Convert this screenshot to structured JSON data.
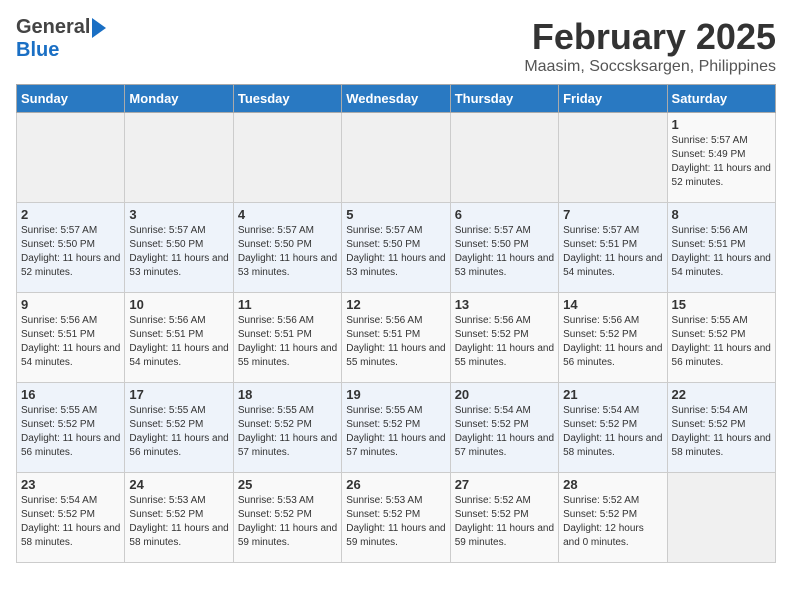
{
  "header": {
    "logo_general": "General",
    "logo_blue": "Blue",
    "title": "February 2025",
    "subtitle": "Maasim, Soccsksargen, Philippines"
  },
  "weekdays": [
    "Sunday",
    "Monday",
    "Tuesday",
    "Wednesday",
    "Thursday",
    "Friday",
    "Saturday"
  ],
  "weeks": [
    [
      {
        "day": "",
        "info": ""
      },
      {
        "day": "",
        "info": ""
      },
      {
        "day": "",
        "info": ""
      },
      {
        "day": "",
        "info": ""
      },
      {
        "day": "",
        "info": ""
      },
      {
        "day": "",
        "info": ""
      },
      {
        "day": "1",
        "info": "Sunrise: 5:57 AM\nSunset: 5:49 PM\nDaylight: 11 hours\nand 52 minutes."
      }
    ],
    [
      {
        "day": "2",
        "info": "Sunrise: 5:57 AM\nSunset: 5:50 PM\nDaylight: 11 hours\nand 52 minutes."
      },
      {
        "day": "3",
        "info": "Sunrise: 5:57 AM\nSunset: 5:50 PM\nDaylight: 11 hours\nand 53 minutes."
      },
      {
        "day": "4",
        "info": "Sunrise: 5:57 AM\nSunset: 5:50 PM\nDaylight: 11 hours\nand 53 minutes."
      },
      {
        "day": "5",
        "info": "Sunrise: 5:57 AM\nSunset: 5:50 PM\nDaylight: 11 hours\nand 53 minutes."
      },
      {
        "day": "6",
        "info": "Sunrise: 5:57 AM\nSunset: 5:50 PM\nDaylight: 11 hours\nand 53 minutes."
      },
      {
        "day": "7",
        "info": "Sunrise: 5:57 AM\nSunset: 5:51 PM\nDaylight: 11 hours\nand 54 minutes."
      },
      {
        "day": "8",
        "info": "Sunrise: 5:56 AM\nSunset: 5:51 PM\nDaylight: 11 hours\nand 54 minutes."
      }
    ],
    [
      {
        "day": "9",
        "info": "Sunrise: 5:56 AM\nSunset: 5:51 PM\nDaylight: 11 hours\nand 54 minutes."
      },
      {
        "day": "10",
        "info": "Sunrise: 5:56 AM\nSunset: 5:51 PM\nDaylight: 11 hours\nand 54 minutes."
      },
      {
        "day": "11",
        "info": "Sunrise: 5:56 AM\nSunset: 5:51 PM\nDaylight: 11 hours\nand 55 minutes."
      },
      {
        "day": "12",
        "info": "Sunrise: 5:56 AM\nSunset: 5:51 PM\nDaylight: 11 hours\nand 55 minutes."
      },
      {
        "day": "13",
        "info": "Sunrise: 5:56 AM\nSunset: 5:52 PM\nDaylight: 11 hours\nand 55 minutes."
      },
      {
        "day": "14",
        "info": "Sunrise: 5:56 AM\nSunset: 5:52 PM\nDaylight: 11 hours\nand 56 minutes."
      },
      {
        "day": "15",
        "info": "Sunrise: 5:55 AM\nSunset: 5:52 PM\nDaylight: 11 hours\nand 56 minutes."
      }
    ],
    [
      {
        "day": "16",
        "info": "Sunrise: 5:55 AM\nSunset: 5:52 PM\nDaylight: 11 hours\nand 56 minutes."
      },
      {
        "day": "17",
        "info": "Sunrise: 5:55 AM\nSunset: 5:52 PM\nDaylight: 11 hours\nand 56 minutes."
      },
      {
        "day": "18",
        "info": "Sunrise: 5:55 AM\nSunset: 5:52 PM\nDaylight: 11 hours\nand 57 minutes."
      },
      {
        "day": "19",
        "info": "Sunrise: 5:55 AM\nSunset: 5:52 PM\nDaylight: 11 hours\nand 57 minutes."
      },
      {
        "day": "20",
        "info": "Sunrise: 5:54 AM\nSunset: 5:52 PM\nDaylight: 11 hours\nand 57 minutes."
      },
      {
        "day": "21",
        "info": "Sunrise: 5:54 AM\nSunset: 5:52 PM\nDaylight: 11 hours\nand 58 minutes."
      },
      {
        "day": "22",
        "info": "Sunrise: 5:54 AM\nSunset: 5:52 PM\nDaylight: 11 hours\nand 58 minutes."
      }
    ],
    [
      {
        "day": "23",
        "info": "Sunrise: 5:54 AM\nSunset: 5:52 PM\nDaylight: 11 hours\nand 58 minutes."
      },
      {
        "day": "24",
        "info": "Sunrise: 5:53 AM\nSunset: 5:52 PM\nDaylight: 11 hours\nand 58 minutes."
      },
      {
        "day": "25",
        "info": "Sunrise: 5:53 AM\nSunset: 5:52 PM\nDaylight: 11 hours\nand 59 minutes."
      },
      {
        "day": "26",
        "info": "Sunrise: 5:53 AM\nSunset: 5:52 PM\nDaylight: 11 hours\nand 59 minutes."
      },
      {
        "day": "27",
        "info": "Sunrise: 5:52 AM\nSunset: 5:52 PM\nDaylight: 11 hours\nand 59 minutes."
      },
      {
        "day": "28",
        "info": "Sunrise: 5:52 AM\nSunset: 5:52 PM\nDaylight: 12 hours\nand 0 minutes."
      },
      {
        "day": "",
        "info": ""
      }
    ]
  ]
}
